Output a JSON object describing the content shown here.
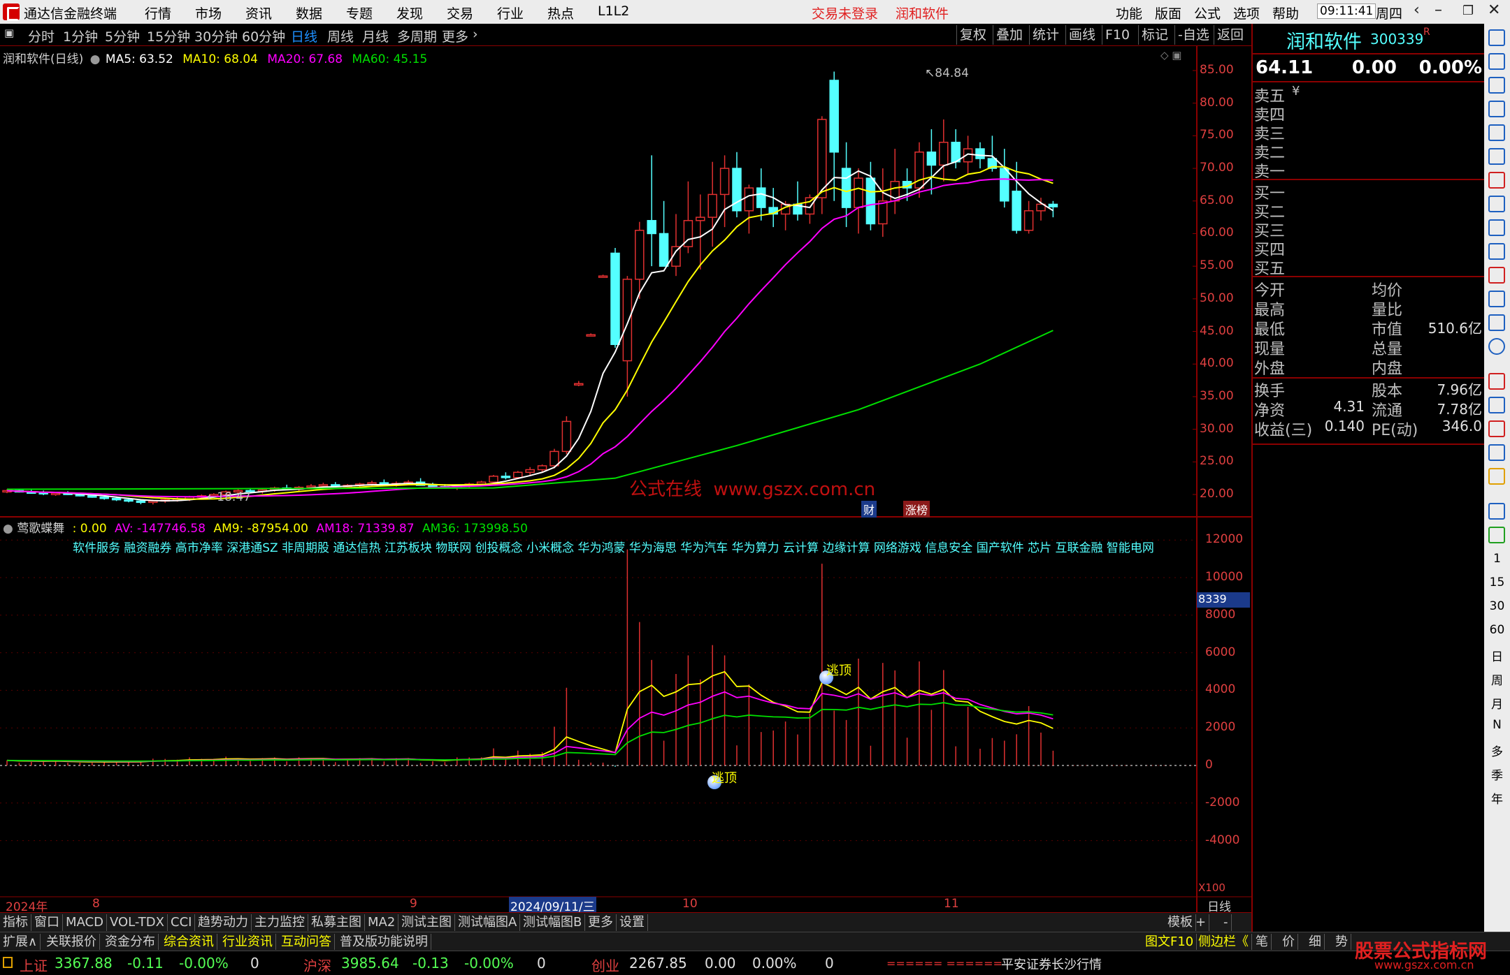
{
  "app": {
    "title": "通达信金融终端",
    "menu": [
      "行情",
      "市场",
      "资讯",
      "数据",
      "专题",
      "发现",
      "交易",
      "行业",
      "热点",
      "L1L2"
    ],
    "trade_status": "交易未登录",
    "stock_name": "润和软件",
    "right_menu": [
      "功能",
      "版面",
      "公式",
      "选项",
      "帮助"
    ],
    "time": "09:11:41",
    "weekday": "周四"
  },
  "period_bar": {
    "periods": [
      "分时",
      "1分钟",
      "5分钟",
      "15分钟",
      "30分钟",
      "60分钟",
      "日线",
      "周线",
      "月线",
      "多周期",
      "更多"
    ],
    "active": "日线",
    "tools": [
      "复权",
      "叠加",
      "统计",
      "画线",
      "F10",
      "标记",
      "-自选",
      "返回"
    ]
  },
  "kline": {
    "title": "润和软件(日线)",
    "ma5": "MA5: 63.52",
    "ma10": "MA10: 68.04",
    "ma20": "MA20: 67.68",
    "ma60": "MA60: 45.15",
    "high_label": "84.84",
    "low_label": "18.47",
    "y_ticks": [
      "85.00",
      "80.00",
      "75.00",
      "70.00",
      "65.00",
      "60.00",
      "55.00",
      "50.00",
      "45.00",
      "40.00",
      "35.00",
      "30.00",
      "25.00",
      "20.00"
    ],
    "watermark": "公式在线  www.gszx.com.cn",
    "badge_cai": "财",
    "badge_zhang": "涨榜"
  },
  "chart_data": {
    "type": "candlestick",
    "title": "润和软件(日线)",
    "ylim": [
      15,
      87
    ],
    "candles": [
      [
        20.5,
        20.8,
        20.2,
        20.6
      ],
      [
        20.6,
        20.9,
        20.3,
        20.4
      ],
      [
        20.4,
        20.7,
        20.1,
        20.3
      ],
      [
        20.3,
        20.6,
        19.9,
        20.1
      ],
      [
        20.1,
        20.4,
        19.8,
        20.2
      ],
      [
        20.2,
        20.5,
        19.9,
        20.0
      ],
      [
        20.0,
        20.3,
        19.7,
        19.8
      ],
      [
        19.8,
        20.1,
        19.5,
        19.6
      ],
      [
        19.6,
        19.9,
        19.2,
        19.4
      ],
      [
        19.4,
        19.7,
        19.0,
        19.2
      ],
      [
        19.2,
        19.5,
        18.8,
        19.0
      ],
      [
        19.0,
        19.3,
        18.5,
        18.8
      ],
      [
        18.8,
        19.2,
        18.47,
        19.0
      ],
      [
        19.0,
        19.4,
        18.7,
        19.2
      ],
      [
        19.2,
        19.6,
        18.9,
        19.3
      ],
      [
        19.3,
        19.8,
        19.0,
        19.6
      ],
      [
        19.6,
        20.0,
        19.3,
        19.8
      ],
      [
        19.8,
        20.2,
        19.5,
        20.0
      ],
      [
        20.0,
        20.6,
        19.8,
        20.4
      ],
      [
        20.4,
        20.9,
        20.1,
        20.6
      ],
      [
        20.6,
        21.0,
        20.2,
        20.5
      ],
      [
        20.5,
        20.9,
        20.1,
        20.7
      ],
      [
        20.7,
        21.2,
        20.4,
        21.0
      ],
      [
        21.0,
        21.5,
        20.7,
        20.8
      ],
      [
        20.8,
        21.3,
        20.5,
        21.1
      ],
      [
        21.1,
        21.6,
        20.8,
        21.3
      ],
      [
        21.3,
        21.8,
        21.0,
        21.5
      ],
      [
        21.5,
        21.9,
        21.1,
        21.2
      ],
      [
        21.2,
        21.6,
        20.9,
        21.4
      ],
      [
        21.4,
        21.8,
        21.0,
        21.6
      ],
      [
        21.6,
        22.1,
        21.3,
        21.8
      ],
      [
        21.8,
        22.3,
        21.4,
        21.5
      ],
      [
        21.5,
        22.0,
        21.2,
        21.7
      ],
      [
        21.7,
        22.2,
        21.4,
        21.9
      ],
      [
        21.9,
        22.5,
        21.6,
        21.4
      ],
      [
        21.4,
        21.8,
        21.0,
        21.2
      ],
      [
        21.2,
        21.6,
        20.9,
        21.0
      ],
      [
        21.0,
        21.5,
        20.7,
        21.3
      ],
      [
        21.3,
        21.8,
        21.0,
        21.6
      ],
      [
        21.6,
        22.1,
        21.3,
        21.9
      ],
      [
        21.9,
        23.0,
        21.6,
        22.8
      ],
      [
        22.8,
        23.4,
        22.3,
        22.6
      ],
      [
        22.6,
        23.6,
        22.4,
        23.4
      ],
      [
        23.4,
        24.2,
        23.0,
        23.8
      ],
      [
        23.8,
        24.6,
        23.4,
        24.4
      ],
      [
        24.4,
        27.0,
        24.0,
        26.6
      ],
      [
        26.6,
        32.0,
        26.2,
        31.2
      ],
      [
        37.0,
        37.4,
        36.6,
        37.0
      ],
      [
        44.5,
        44.7,
        44.3,
        44.5
      ],
      [
        53.5,
        53.7,
        53.3,
        53.5
      ],
      [
        57.0,
        57.8,
        42.5,
        43.0
      ],
      [
        40.5,
        53.5,
        35.0,
        53.0
      ],
      [
        53.0,
        61.8,
        50.0,
        60.5
      ],
      [
        62.0,
        72.0,
        55.0,
        60.0
      ],
      [
        60.0,
        65.0,
        56.0,
        55.0
      ],
      [
        55.0,
        63.0,
        53.5,
        58.0
      ],
      [
        58.0,
        68.0,
        57.0,
        62.0
      ],
      [
        62.0,
        66.0,
        54.5,
        62.5
      ],
      [
        62.5,
        71.0,
        58.0,
        66.0
      ],
      [
        66.0,
        72.0,
        61.0,
        70.0
      ],
      [
        70.0,
        72.5,
        62.5,
        63.5
      ],
      [
        63.5,
        67.5,
        60.0,
        67.0
      ],
      [
        67.0,
        70.0,
        62.0,
        64.0
      ],
      [
        64.0,
        67.0,
        61.0,
        63.0
      ],
      [
        63.0,
        65.0,
        60.5,
        64.5
      ],
      [
        64.5,
        68.0,
        62.0,
        63.0
      ],
      [
        63.0,
        66.0,
        61.5,
        65.5
      ],
      [
        65.5,
        78.0,
        63.0,
        77.5
      ],
      [
        83.5,
        84.84,
        65.0,
        72.5
      ],
      [
        70.0,
        74.0,
        61.0,
        64.0
      ],
      [
        64.0,
        70.0,
        60.0,
        68.5
      ],
      [
        68.5,
        71.0,
        60.5,
        61.5
      ],
      [
        61.5,
        70.0,
        59.5,
        65.0
      ],
      [
        65.0,
        73.0,
        63.0,
        68.0
      ],
      [
        68.0,
        70.0,
        65.0,
        67.0
      ],
      [
        67.0,
        74.0,
        65.5,
        72.5
      ],
      [
        72.5,
        76.0,
        66.0,
        70.5
      ],
      [
        70.5,
        77.5,
        68.0,
        74.0
      ],
      [
        74.0,
        76.0,
        70.0,
        71.0
      ],
      [
        71.0,
        75.0,
        69.0,
        73.0
      ],
      [
        73.0,
        74.0,
        70.0,
        71.5
      ],
      [
        71.5,
        75.0,
        69.5,
        70.0
      ],
      [
        70.0,
        73.0,
        64.0,
        65.0
      ],
      [
        66.5,
        71.0,
        60.0,
        60.5
      ],
      [
        60.5,
        65.0,
        60.0,
        63.5
      ],
      [
        63.5,
        65.5,
        62.0,
        64.5
      ],
      [
        64.5,
        65.0,
        62.5,
        64.11
      ]
    ],
    "ma5": [
      [
        67,
        68.5
      ],
      [
        71,
        66.5
      ],
      [
        76,
        66
      ],
      [
        78,
        65.3
      ],
      [
        82,
        64.5
      ]
    ],
    "ma10": [
      [
        40,
        24
      ],
      [
        50,
        40
      ],
      [
        55,
        55
      ],
      [
        60,
        63
      ],
      [
        66,
        64
      ],
      [
        72,
        66
      ],
      [
        78,
        71
      ],
      [
        82,
        70
      ],
      [
        86,
        68
      ]
    ],
    "ma20": [
      [
        40,
        22
      ],
      [
        50,
        28
      ],
      [
        56,
        40
      ],
      [
        62,
        52
      ],
      [
        70,
        61
      ],
      [
        76,
        67
      ],
      [
        80,
        68
      ],
      [
        86,
        68
      ]
    ],
    "ma60": [
      [
        0,
        20.8
      ],
      [
        40,
        21
      ],
      [
        50,
        22.5
      ],
      [
        60,
        27.5
      ],
      [
        70,
        33
      ],
      [
        80,
        40
      ],
      [
        86,
        45.15
      ]
    ]
  },
  "sub": {
    "name": "莺歌蝶舞",
    "v0": ": 0.00",
    "av": "AV: -147746.58",
    "am9": "AM9: -87954.00",
    "am18": "AM18: 71339.87",
    "am36": "AM36: 173998.50",
    "concepts": "软件服务 融资融券 高市净率 深港通SZ 非周期股 通达信热 江苏板块 物联网 创投概念 小米概念 华为鸿蒙 华为海思 华为汽车 华为算力 云计算 边缘计算 网络游戏 信息安全 国产软件 芯片 互联金融 智能电网",
    "y_ticks": [
      "12000",
      "10000",
      "8000",
      "6000",
      "4000",
      "2000",
      "0",
      "-2000",
      "-4000"
    ],
    "code_tag": "8339",
    "x100": "X100",
    "escape_top": "逃顶",
    "escape_bottom": "逃顶"
  },
  "xaxis": {
    "labels": [
      "2024年",
      "8",
      "9",
      "2024/09/11/三",
      "10",
      "11"
    ],
    "period": "日线"
  },
  "quote": {
    "name": "润和软件",
    "code": "300339",
    "flag": "R",
    "price": "64.11",
    "change": "0.00",
    "pct": "0.00%",
    "sell": [
      "卖五",
      "卖四",
      "卖三",
      "卖二",
      "卖一"
    ],
    "buy": [
      "买一",
      "买二",
      "买三",
      "买四",
      "买五"
    ],
    "yen": "¥",
    "rows1": [
      [
        "今开",
        "",
        "均价",
        ""
      ],
      [
        "最高",
        "",
        "量比",
        ""
      ],
      [
        "最低",
        "",
        "市值",
        "510.6亿"
      ],
      [
        "现量",
        "",
        "总量",
        ""
      ],
      [
        "外盘",
        "",
        "内盘",
        ""
      ]
    ],
    "rows2": [
      [
        "换手",
        "",
        "股本",
        "7.96亿"
      ],
      [
        "净资",
        "4.31",
        "流通",
        "7.78亿"
      ],
      [
        "收益(三)",
        "0.140",
        "PE(动)",
        "346.0"
      ]
    ]
  },
  "tabs": [
    "指标",
    "窗口",
    "MACD",
    "VOL-TDX",
    "CCI",
    "趋势动力",
    "主力监控",
    "私募主图",
    "MA2",
    "测试主图",
    "测试幅图A",
    "测试幅图B",
    "更多",
    "设置"
  ],
  "tabs_right": [
    "模板",
    "+",
    "-"
  ],
  "ext": {
    "items": [
      "扩展∧",
      "关联报价",
      "资金分布",
      "综合资讯",
      "行业资讯",
      "互动问答",
      "普及版功能说明"
    ],
    "right": [
      "图文F10",
      "侧边栏《",
      "笔",
      "价",
      "细",
      "势"
    ]
  },
  "status": {
    "sh_name": "上证",
    "sh_val": "3367.88",
    "sh_chg": "-0.11",
    "sh_pct": "-0.00%",
    "sh_vol": "0",
    "hs_name": "沪深",
    "hs_val": "3985.64",
    "hs_chg": "-0.13",
    "hs_pct": "-0.00%",
    "hs_vol": "0",
    "cy_name": "创业",
    "cy_val": "2267.85",
    "cy_chg": "0.00",
    "cy_pct": "0.00%",
    "cy_vol": "0",
    "bars": "====== ======",
    "broker": "平安证券长沙行情",
    "brand": "股票公式指标网",
    "brand_url": "www.gszx.com.cn"
  },
  "side_tools": [
    "1",
    "15",
    "30",
    "60",
    "日",
    "周",
    "月",
    "N",
    "多",
    "季",
    "年"
  ],
  "colors": {
    "up": "#e03030",
    "down": "#54ffff",
    "ma5": "#ffffff",
    "ma10": "#ffff00",
    "ma20": "#ff00ff",
    "ma60": "#00e000",
    "axis": "#8b0000"
  }
}
